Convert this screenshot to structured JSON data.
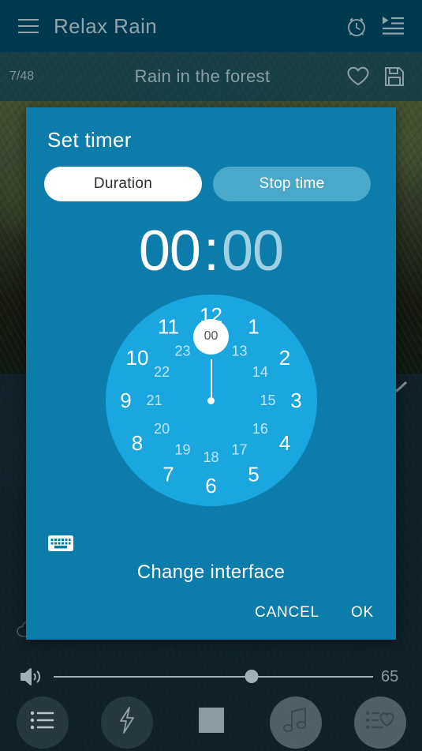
{
  "appbar": {
    "title": "Relax Rain",
    "menu_icon": "hamburger-menu-icon",
    "alarm_icon": "alarm-clock-icon",
    "playlist_icon": "playlist-icon"
  },
  "trackbar": {
    "counter": "7/48",
    "title": "Rain in the forest",
    "favorite_icon": "heart-outline-icon",
    "save_icon": "floppy-save-icon"
  },
  "background": {
    "collapse_icon": "chevron-down-icon",
    "cloud_icon": "cloud-icon"
  },
  "dialog": {
    "title": "Set timer",
    "tabs": [
      {
        "label": "Duration",
        "active": true
      },
      {
        "label": "Stop time",
        "active": false
      }
    ],
    "time": {
      "hours": "00",
      "minutes": "00",
      "separator": ":",
      "selected_unit": "hours"
    },
    "clock": {
      "mode": "24-hour",
      "selected_value": "00",
      "outer_ring": [
        "12",
        "1",
        "2",
        "3",
        "4",
        "5",
        "6",
        "7",
        "8",
        "9",
        "10",
        "11"
      ],
      "inner_ring": [
        "00",
        "13",
        "14",
        "15",
        "16",
        "17",
        "18",
        "19",
        "20",
        "21",
        "22",
        "23"
      ],
      "face_color": "#1aa7e0",
      "selection_color": "#ffffff"
    },
    "keyboard_icon": "keyboard-icon",
    "change_interface_label": "Change interface",
    "cancel_label": "CANCEL",
    "ok_label": "OK",
    "background_color": "#0c7cab"
  },
  "player": {
    "volume_icon": "speaker-volume-icon",
    "volume_value": "65",
    "volume_percent": 62,
    "nav": [
      {
        "name": "list-button",
        "icon": "bullet-list-icon"
      },
      {
        "name": "effects-button",
        "icon": "lightning-bolt-icon"
      },
      {
        "name": "stop-button",
        "icon": "stop-square-icon"
      },
      {
        "name": "music-button",
        "icon": "music-note-icon"
      },
      {
        "name": "favorites-button",
        "icon": "list-heart-icon"
      }
    ]
  }
}
